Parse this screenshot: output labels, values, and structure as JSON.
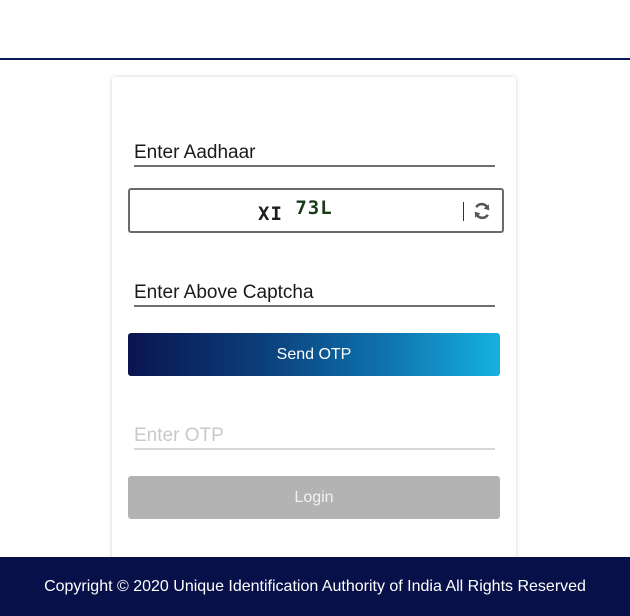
{
  "form": {
    "aadhaar_placeholder": "Enter Aadhaar",
    "captcha": {
      "image_text_part1": "XI",
      "image_text_part2": "73L",
      "refresh_icon": "refresh-icon"
    },
    "captcha_placeholder": "Enter Above Captcha",
    "send_otp_label": "Send OTP",
    "otp_placeholder": "Enter OTP",
    "login_label": "Login"
  },
  "footer": {
    "copyright": "Copyright © 2020 Unique Identification Authority of India All Rights Reserved"
  },
  "colors": {
    "header_rule": "#0a1a55",
    "footer_bg": "#08104a",
    "send_otp_gradient_start": "#0a1450",
    "send_otp_gradient_end": "#16b0df",
    "login_disabled_bg": "#b3b3b3"
  }
}
